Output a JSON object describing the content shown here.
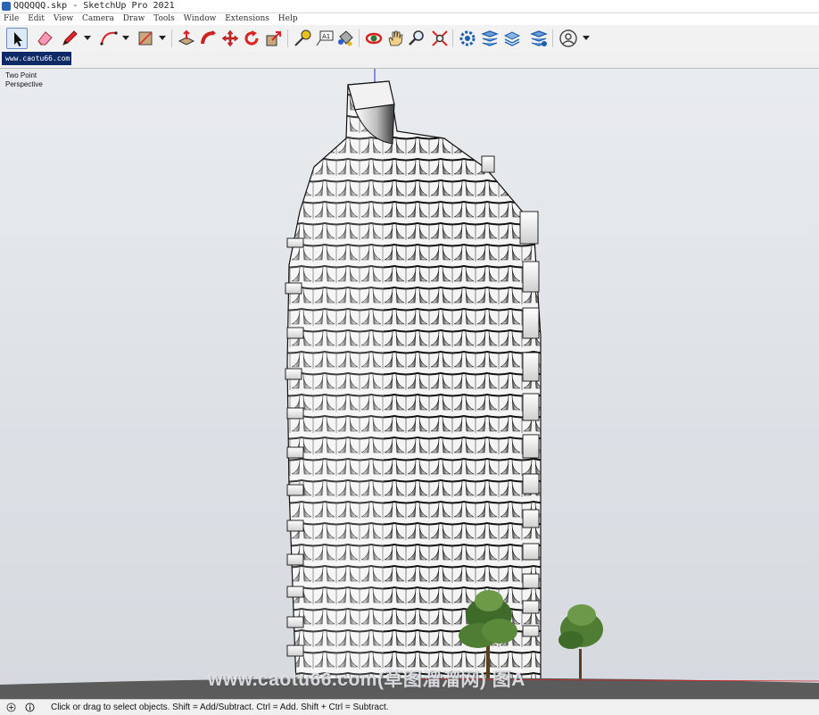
{
  "window": {
    "title": "QQQQQQ.skp - SketchUp Pro 2021"
  },
  "menu": [
    "File",
    "Edit",
    "View",
    "Camera",
    "Draw",
    "Tools",
    "Window",
    "Extensions",
    "Help"
  ],
  "tab": {
    "label": "www.caotu66.com"
  },
  "viewport": {
    "camera_label_1": "Two Point",
    "camera_label_2": "Perspective",
    "watermark": "www.caotu66.com(草图溜溜网) 图A"
  },
  "toolbar": {
    "tools": [
      "select",
      "eraser",
      "pencil",
      "arc",
      "rectangle",
      "push-pull",
      "follow-me",
      "move",
      "rotate",
      "scale",
      "tape-measure",
      "text",
      "paint-bucket",
      "orbit",
      "pan",
      "zoom",
      "zoom-extents",
      "3d-warehouse",
      "extension-warehouse",
      "layout",
      "extension-manager",
      "account"
    ]
  },
  "status": {
    "message": "Click or drag to select objects. Shift = Add/Subtract. Ctrl = Add. Shift + Ctrl = Subtract."
  },
  "colors": {
    "tab_bg": "#0d2a66",
    "sky_top": "#e9ecef",
    "ground": "#5b5b5b",
    "axis_blue": "#1a2ecc"
  }
}
